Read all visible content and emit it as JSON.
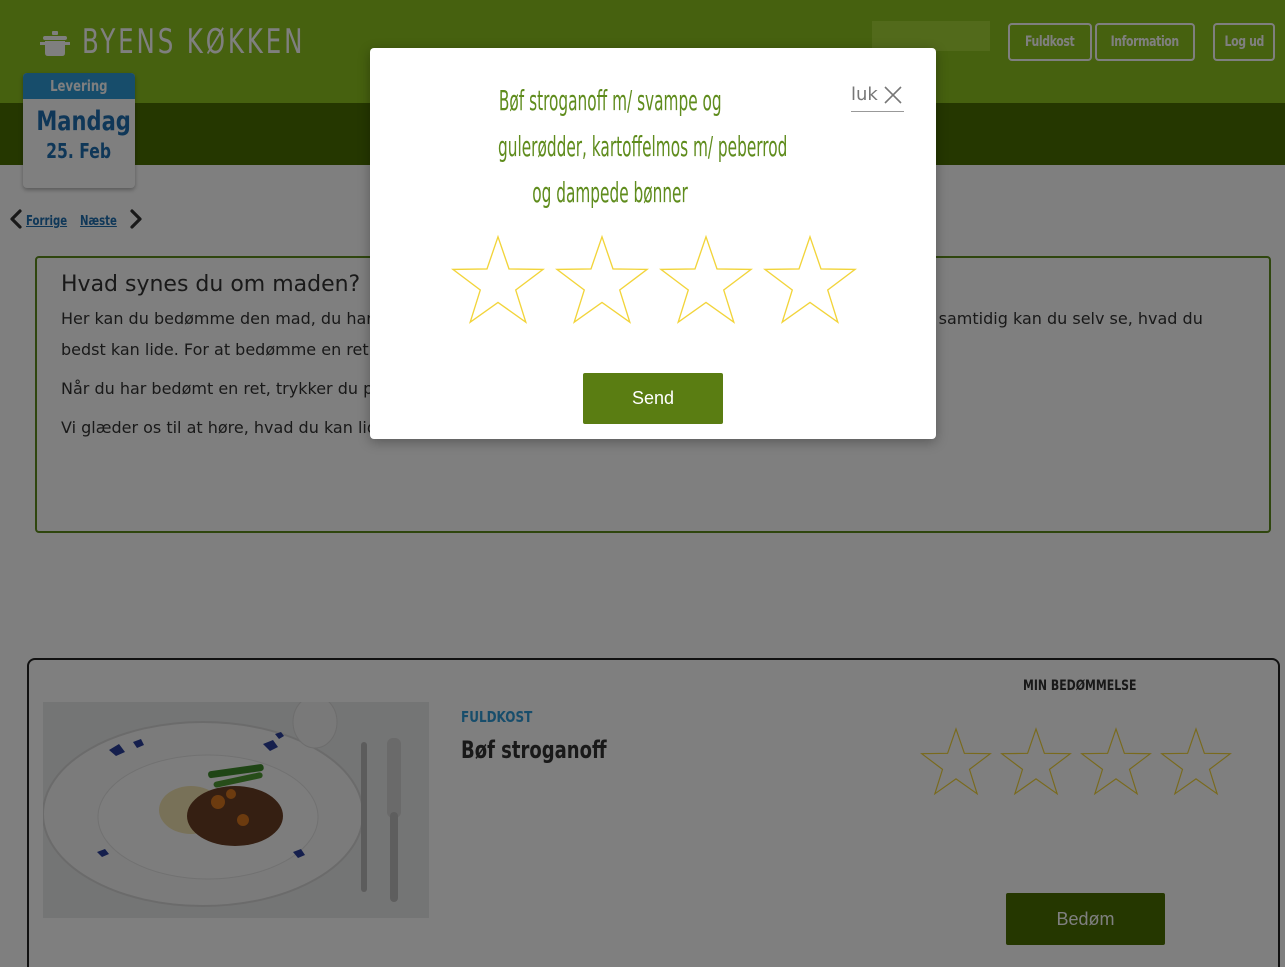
{
  "header": {
    "logo_text": "BYENS KØKKEN",
    "nav": {
      "fuldkost": "Fuldkost",
      "information": "Information",
      "logout": "Log ud"
    }
  },
  "delivery": {
    "label": "Levering",
    "day": "Mandag",
    "date": "25. Feb",
    "prev": "Forrige",
    "next": "Næste"
  },
  "info": {
    "heading": "Hvad synes du om maden?",
    "paragraph1": "Her kan du bedømme den mad, du har fået leveret. På den måde kan vi se, hvilke retter der er populære, og samtidig kan du selv se, hvad du bedst kan lide. For at bedømme en ret trykker du på knappen 'Bedøm'. Du kan give 1 til 4 stjerner.",
    "paragraph2": "Når du har bedømt en ret, trykker du på knappen 'Send'.",
    "paragraph3": "Vi glæder os til at høre, hvad du kan lide."
  },
  "dish": {
    "category": "FULDKOST",
    "name": "Bøf stroganoff",
    "my_rating_label": "MIN BEDØMMELSE",
    "rating": 0,
    "max_rating": 4,
    "rate_button": "Bedøm"
  },
  "modal": {
    "title_lines": [
      "Bøf stroganoff m/ svampe og",
      "gulerødder, kartoffelmos m/ peberrod",
      "og dampede bønner"
    ],
    "close_label": "luk",
    "rating": 0,
    "max_rating": 4,
    "send_button": "Send"
  },
  "colors": {
    "header_green": "#8dc21f",
    "dark_green": "#4a6e00",
    "title_green": "#5f8c1d",
    "accent_blue": "#2f9ad6",
    "star_outline": "#f2d43a"
  },
  "icons": {
    "logo": "cooking-pot-icon",
    "prev": "chevron-left-icon",
    "next": "chevron-right-icon",
    "close": "close-icon",
    "star": "star-outline-icon"
  }
}
